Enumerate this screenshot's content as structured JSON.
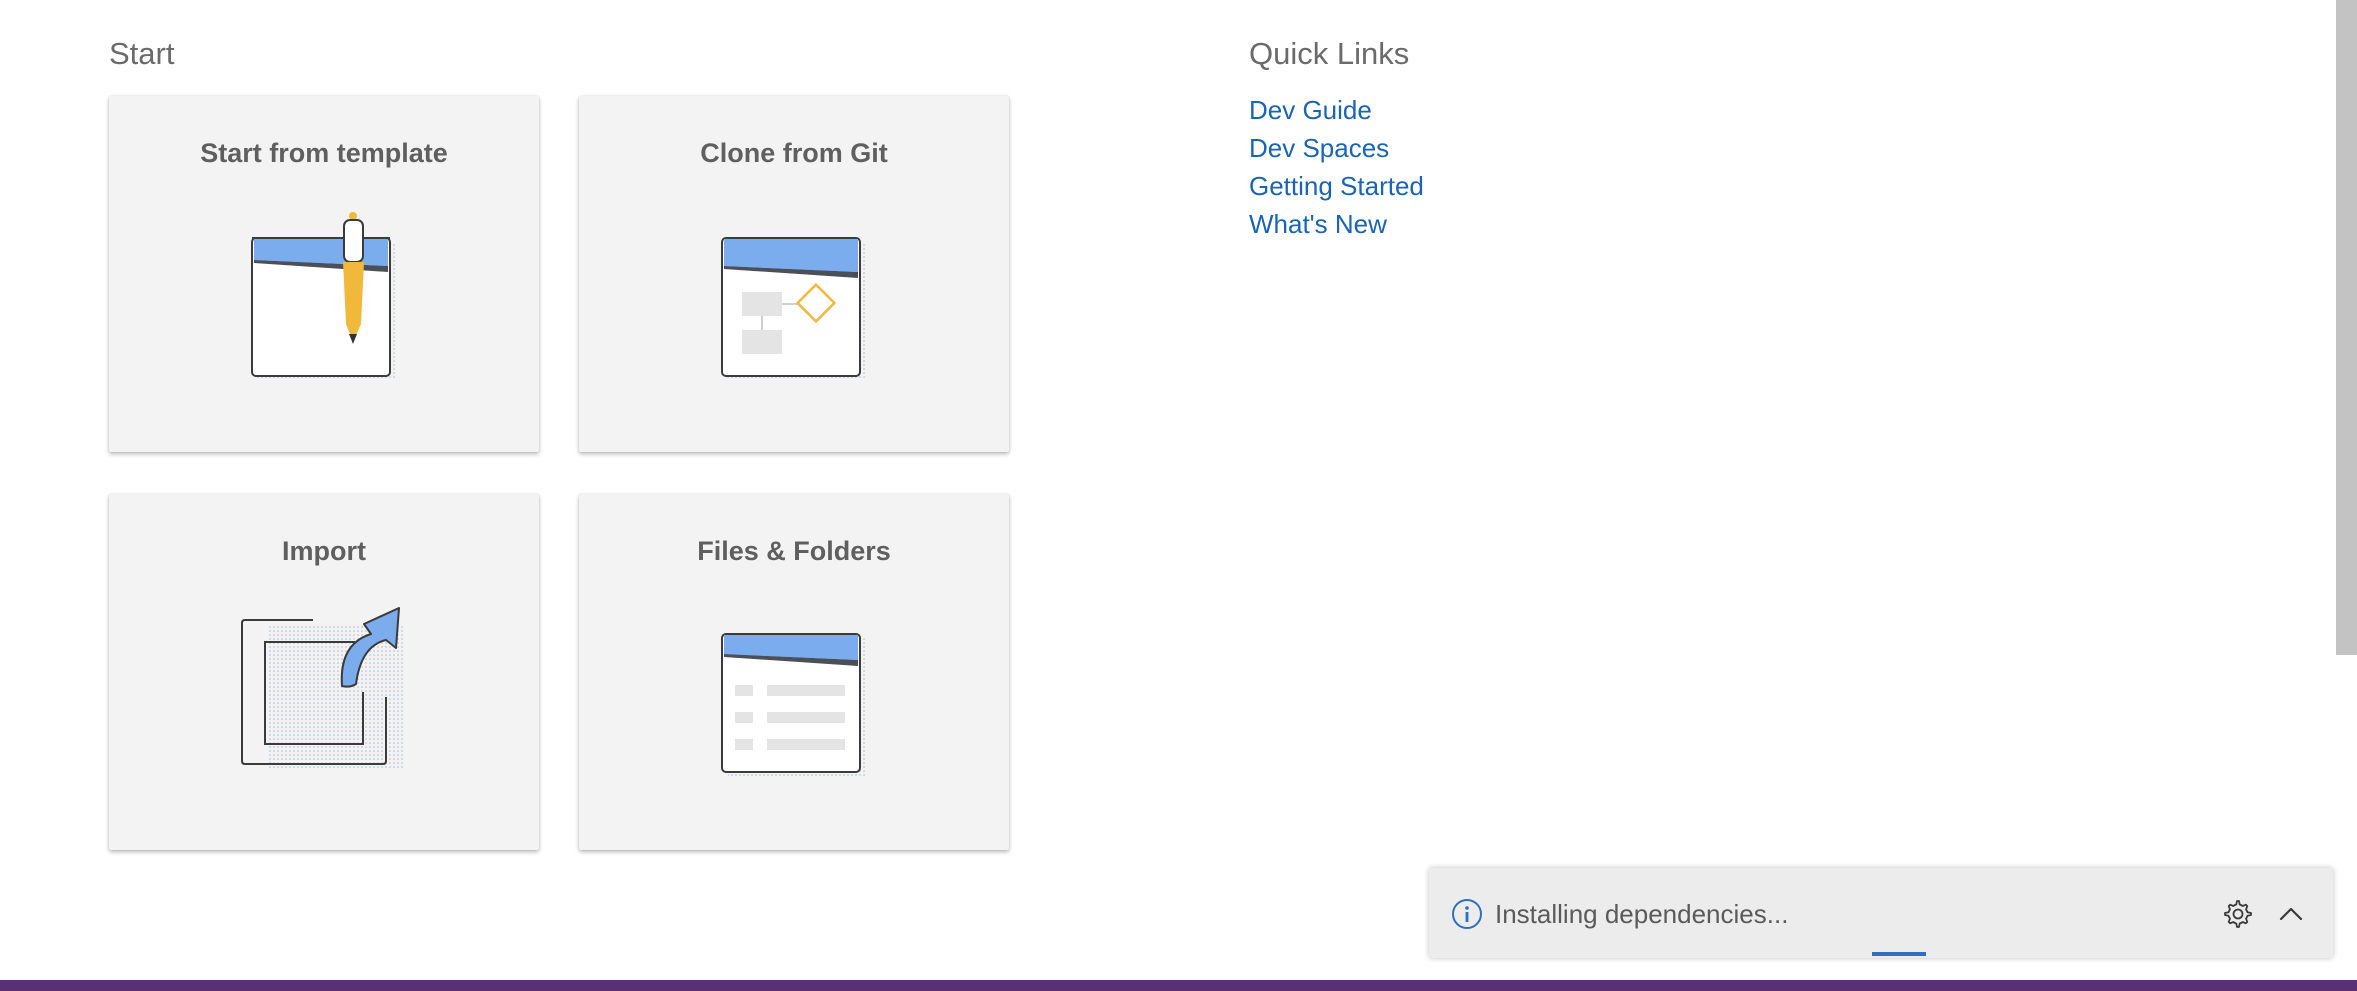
{
  "start": {
    "title": "Start",
    "cards": [
      {
        "id": "template",
        "title": "Start from template",
        "icon": "template-pen-icon"
      },
      {
        "id": "git",
        "title": "Clone from Git",
        "icon": "git-flow-icon"
      },
      {
        "id": "import",
        "title": "Import",
        "icon": "import-arrow-icon"
      },
      {
        "id": "files",
        "title": "Files & Folders",
        "icon": "files-list-icon"
      }
    ]
  },
  "quick_links": {
    "title": "Quick Links",
    "items": [
      "Dev Guide",
      "Dev Spaces",
      "Getting Started",
      "What's New"
    ]
  },
  "notification": {
    "icon": "info-icon",
    "message": "Installing dependencies...",
    "settings_icon": "gear-icon",
    "expand_icon": "chevron-up-icon"
  },
  "colors": {
    "accent_blue": "#7aacee",
    "pen_yellow": "#f1b93c",
    "link": "#1a64b4",
    "status_bar": "#5b2f73"
  }
}
